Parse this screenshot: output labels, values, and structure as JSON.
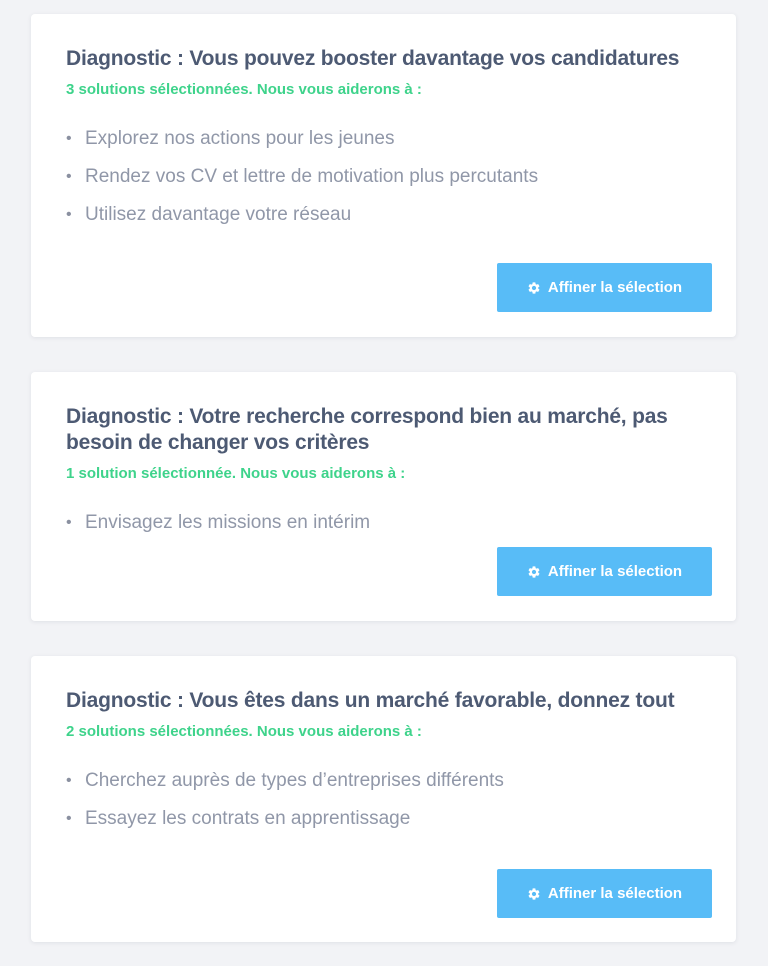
{
  "cards": [
    {
      "title": "Diagnostic : Vous pouvez booster davantage vos candidatures",
      "subtitle": "3 solutions sélectionnées. Nous vous aiderons à :",
      "items": [
        "Explorez nos actions pour les jeunes",
        "Rendez vos CV et lettre de motivation plus percutants",
        "Utilisez davantage votre réseau"
      ],
      "button_label": "Affiner la sélection",
      "button_icon": "gear-icon"
    },
    {
      "title": "Diagnostic : Votre recherche correspond bien au marché, pas besoin de changer vos critères",
      "subtitle": "1 solution sélectionnée. Nous vous aiderons à :",
      "items": [
        "Envisagez les missions en intérim"
      ],
      "button_label": "Affiner la sélection",
      "button_icon": "gear-icon"
    },
    {
      "title": "Diagnostic : Vous êtes dans un marché favorable, donnez tout",
      "subtitle": "2 solutions sélectionnées. Nous vous aiderons à :",
      "items": [
        "Cherchez auprès de types d’entreprises différents",
        "Essayez les contrats en apprentissage"
      ],
      "button_label": "Affiner la sélection",
      "button_icon": "gear-icon"
    }
  ],
  "bullet_char": "•",
  "colors": {
    "background": "#f2f3f6",
    "card": "#ffffff",
    "title": "#4d5a73",
    "subtitle_accent": "#3ed38b",
    "item_text": "#9097a8",
    "button": "#58bcf7",
    "button_text": "#ffffff"
  }
}
